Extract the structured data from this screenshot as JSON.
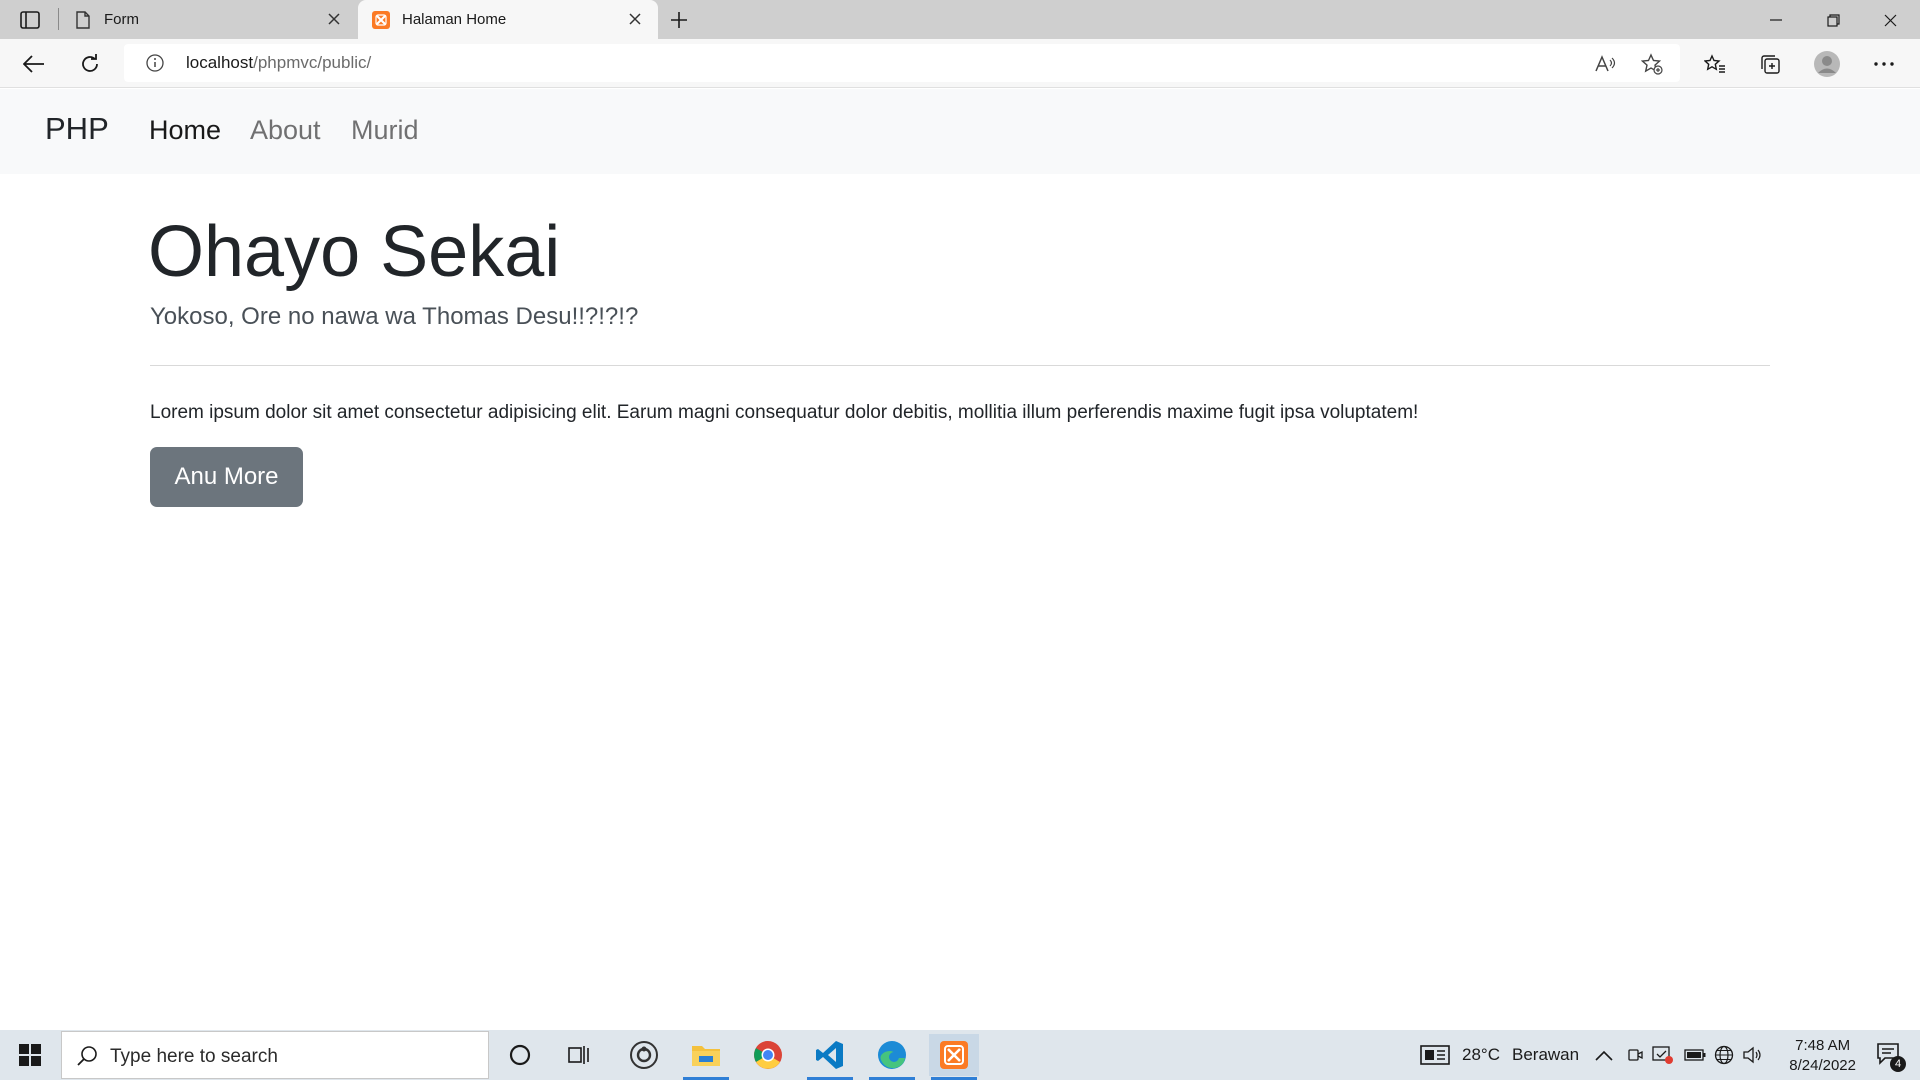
{
  "browser": {
    "tabs": [
      {
        "title": "Form",
        "favicon": "page-icon",
        "active": false
      },
      {
        "title": "Halaman Home",
        "favicon": "xampp-icon",
        "active": true
      }
    ],
    "url_host": "localhost",
    "url_path": "/phpmvc/public/"
  },
  "page": {
    "brand": "PHP",
    "nav": [
      {
        "label": "Home",
        "active": true
      },
      {
        "label": "About",
        "active": false
      },
      {
        "label": "Murid",
        "active": false
      }
    ],
    "heading": "Ohayo Sekai",
    "lead": "Yokoso, Ore no nawa wa Thomas Desu!!?!?!?",
    "paragraph": "Lorem ipsum dolor sit amet consectetur adipisicing elit. Earum magni consequatur dolor debitis, mollitia illum perferendis maxime fugit ipsa voluptatem!",
    "button_label": "Anu More",
    "button_color": "#6c757d"
  },
  "taskbar": {
    "search_placeholder": "Type here to search",
    "apps": [
      "cortana-icon",
      "task-view-icon",
      "obs-icon",
      "file-explorer-icon",
      "chrome-icon",
      "vscode-icon",
      "edge-icon",
      "xampp-icon"
    ],
    "weather_temp": "28°C",
    "weather_desc": "Berawan",
    "time": "7:48 AM",
    "date": "8/24/2022",
    "notification_count": "4"
  },
  "colors": {
    "navbar_bg": "#f8f9fa",
    "taskbar_bg": "#dfe6ec",
    "xampp_orange": "#fb7a24"
  }
}
